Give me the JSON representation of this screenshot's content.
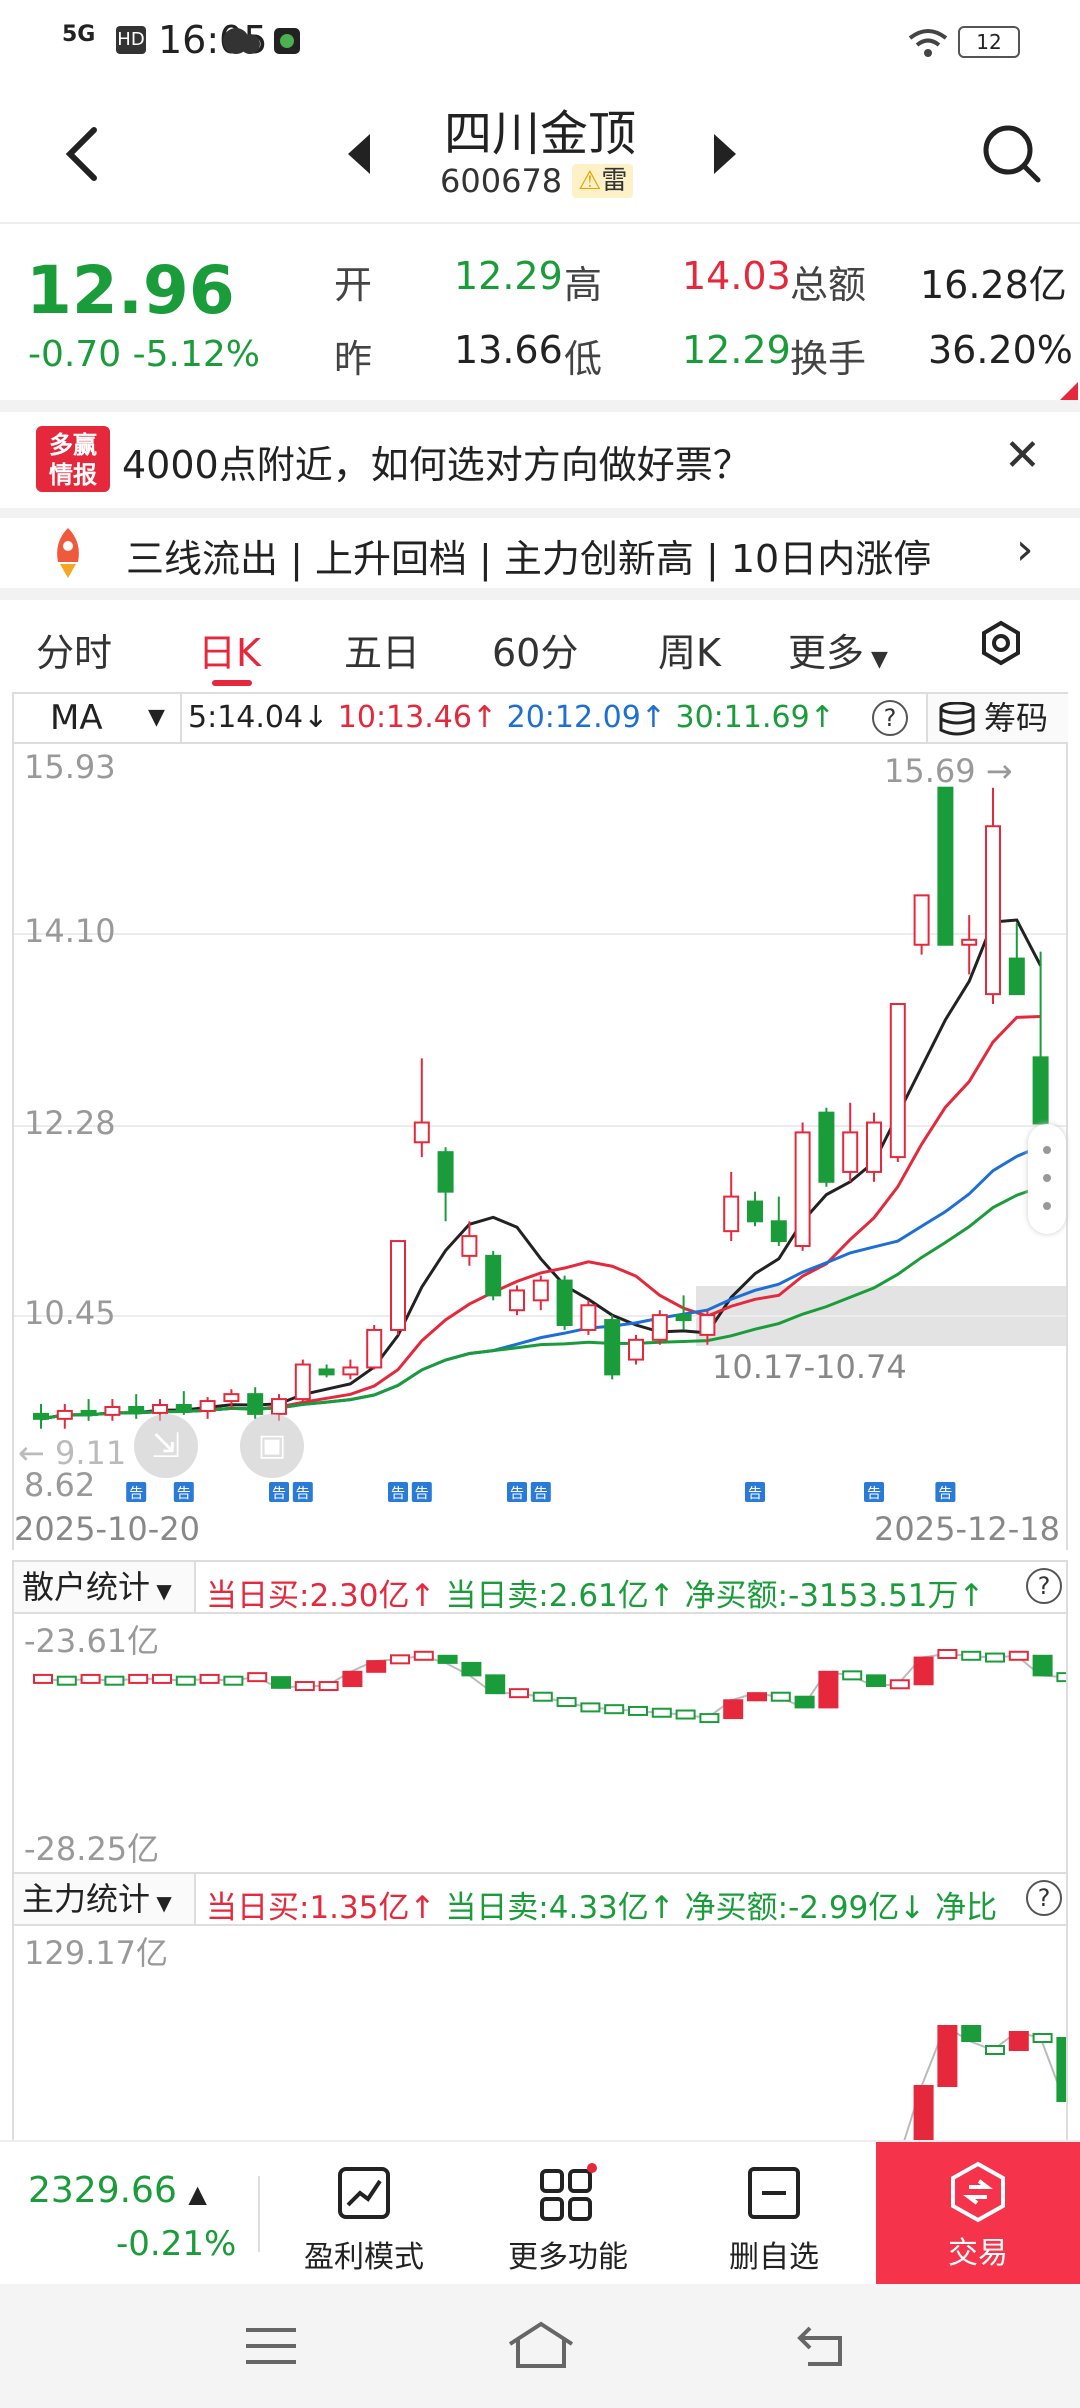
{
  "status_bar": {
    "time": "16:05",
    "network": "5G",
    "hd": "HD",
    "battery": "12"
  },
  "header": {
    "stock_name": "四川金顶",
    "stock_code": "600678",
    "risk_tag": "雷"
  },
  "quote": {
    "price": "12.96",
    "change": "-0.70",
    "change_pct": "-5.12%",
    "open_label": "开",
    "open": "12.29",
    "high_label": "高",
    "high": "14.03",
    "amount_label": "总额",
    "amount": "16.28亿",
    "prev_label": "昨",
    "prev": "13.66",
    "low_label": "低",
    "low": "12.29",
    "turnover_label": "换手",
    "turnover": "36.20%"
  },
  "news": {
    "logo_line1": "多赢",
    "logo_line2": "情报",
    "text": "4000点附近，如何选对方向做好票？"
  },
  "tags_bar": {
    "text": "三线流出 | 上升回档 | 主力创新高 | 10日内涨停"
  },
  "tabs": [
    {
      "label": "分时"
    },
    {
      "label": "日K"
    },
    {
      "label": "五日"
    },
    {
      "label": "60分"
    },
    {
      "label": "周K"
    },
    {
      "label": "更多"
    }
  ],
  "indicator": {
    "selected": "MA",
    "ma5": "5:14.04↓",
    "ma10": "10:13.46↑",
    "ma20": "20:12.09↑",
    "ma30": "30:11.69↑",
    "chip_label": "筹码"
  },
  "chart_data": {
    "type": "candlestick",
    "y_ticks": [
      "15.93",
      "14.10",
      "12.28",
      "10.45",
      "8.62"
    ],
    "ylim": [
      8.62,
      15.93
    ],
    "x_start": "2025-10-20",
    "x_end": "2025-12-18",
    "annotations": {
      "high_marker": "15.69",
      "low_marker": "9.11",
      "zone": "10.17-10.74",
      "notice": "告"
    },
    "colors": {
      "up": "#e5283c",
      "down": "#1a9c3b",
      "ma5": "#222222",
      "ma10": "#e5283c",
      "ma20": "#1d6fd6",
      "ma30": "#1a9c3b"
    },
    "candles": [
      {
        "o": 9.35,
        "h": 9.45,
        "l": 9.2,
        "c": 9.3
      },
      {
        "o": 9.3,
        "h": 9.45,
        "l": 9.2,
        "c": 9.38
      },
      {
        "o": 9.38,
        "h": 9.5,
        "l": 9.28,
        "c": 9.34
      },
      {
        "o": 9.34,
        "h": 9.5,
        "l": 9.28,
        "c": 9.42
      },
      {
        "o": 9.42,
        "h": 9.55,
        "l": 9.3,
        "c": 9.36
      },
      {
        "o": 9.36,
        "h": 9.5,
        "l": 9.28,
        "c": 9.44
      },
      {
        "o": 9.44,
        "h": 9.58,
        "l": 9.34,
        "c": 9.38
      },
      {
        "o": 9.38,
        "h": 9.52,
        "l": 9.3,
        "c": 9.48
      },
      {
        "o": 9.48,
        "h": 9.6,
        "l": 9.4,
        "c": 9.55
      },
      {
        "o": 9.55,
        "h": 9.62,
        "l": 9.3,
        "c": 9.35
      },
      {
        "o": 9.35,
        "h": 9.55,
        "l": 9.28,
        "c": 9.5
      },
      {
        "o": 9.5,
        "h": 9.9,
        "l": 9.48,
        "c": 9.85
      },
      {
        "o": 9.8,
        "h": 9.85,
        "l": 9.72,
        "c": 9.75
      },
      {
        "o": 9.75,
        "h": 9.9,
        "l": 9.7,
        "c": 9.82
      },
      {
        "o": 9.82,
        "h": 10.25,
        "l": 9.8,
        "c": 10.2
      },
      {
        "o": 10.2,
        "h": 11.1,
        "l": 10.15,
        "c": 11.1
      },
      {
        "o": 12.1,
        "h": 12.95,
        "l": 11.95,
        "c": 12.3
      },
      {
        "o": 12.0,
        "h": 12.05,
        "l": 11.3,
        "c": 11.6
      },
      {
        "o": 10.95,
        "h": 11.3,
        "l": 10.85,
        "c": 11.15
      },
      {
        "o": 10.95,
        "h": 11.0,
        "l": 10.5,
        "c": 10.55
      },
      {
        "o": 10.4,
        "h": 10.65,
        "l": 10.35,
        "c": 10.6
      },
      {
        "o": 10.5,
        "h": 10.75,
        "l": 10.4,
        "c": 10.7
      },
      {
        "o": 10.7,
        "h": 10.75,
        "l": 10.2,
        "c": 10.25
      },
      {
        "o": 10.2,
        "h": 10.5,
        "l": 10.15,
        "c": 10.45
      },
      {
        "o": 10.3,
        "h": 10.35,
        "l": 9.7,
        "c": 9.75
      },
      {
        "o": 9.9,
        "h": 10.15,
        "l": 9.85,
        "c": 10.1
      },
      {
        "o": 10.1,
        "h": 10.4,
        "l": 10.05,
        "c": 10.35
      },
      {
        "o": 10.35,
        "h": 10.55,
        "l": 10.2,
        "c": 10.3
      },
      {
        "o": 10.15,
        "h": 10.4,
        "l": 10.05,
        "c": 10.35
      },
      {
        "o": 11.2,
        "h": 11.8,
        "l": 11.1,
        "c": 11.55
      },
      {
        "o": 11.5,
        "h": 11.6,
        "l": 11.25,
        "c": 11.3
      },
      {
        "o": 11.3,
        "h": 11.55,
        "l": 11.05,
        "c": 11.1
      },
      {
        "o": 11.05,
        "h": 12.3,
        "l": 11.0,
        "c": 12.2
      },
      {
        "o": 12.4,
        "h": 12.45,
        "l": 11.65,
        "c": 11.7
      },
      {
        "o": 11.8,
        "h": 12.5,
        "l": 11.7,
        "c": 12.2
      },
      {
        "o": 11.8,
        "h": 12.4,
        "l": 11.7,
        "c": 12.3
      },
      {
        "o": 11.95,
        "h": 13.5,
        "l": 11.9,
        "c": 13.5
      },
      {
        "o": 14.1,
        "h": 14.6,
        "l": 14.0,
        "c": 14.6
      },
      {
        "o": 15.69,
        "h": 15.69,
        "l": 14.1,
        "c": 14.1
      },
      {
        "o": 14.1,
        "h": 14.4,
        "l": 13.8,
        "c": 14.15
      },
      {
        "o": 13.6,
        "h": 15.69,
        "l": 13.5,
        "c": 15.3
      },
      {
        "o": 13.96,
        "h": 14.32,
        "l": 13.6,
        "c": 13.6
      },
      {
        "o": 12.96,
        "h": 14.03,
        "l": 12.29,
        "c": 12.29
      }
    ]
  },
  "retail_panel": {
    "name": "散户统计",
    "buy": "当日买:2.30亿↑",
    "sell": "当日卖:2.61亿↑",
    "net": "净买额:-3153.51万↑",
    "y_top": "-23.61亿",
    "y_bottom": "-28.25亿",
    "values": [
      0.86,
      0.85,
      0.86,
      0.85,
      0.86,
      0.86,
      0.85,
      0.86,
      0.85,
      0.87,
      0.81,
      0.82,
      0.82,
      0.9,
      0.96,
      0.97,
      0.99,
      0.95,
      0.88,
      0.78,
      0.78,
      0.76,
      0.73,
      0.7,
      0.69,
      0.68,
      0.67,
      0.66,
      0.64,
      0.74,
      0.78,
      0.76,
      0.7,
      0.9,
      0.88,
      0.82,
      0.83,
      0.98,
      1.0,
      0.99,
      0.98,
      0.99,
      0.88,
      0.87
    ]
  },
  "main_panel": {
    "name": "主力统计",
    "buy": "当日买:1.35亿↑",
    "sell": "当日卖:4.33亿↑",
    "net": "净买额:-2.99亿↓ 净比",
    "y_top": "129.17亿",
    "values": [
      0.0,
      0.0,
      0.0,
      0.0,
      0.0,
      0.0,
      0.0,
      0.0,
      0.0,
      0.0,
      0.0,
      0.0,
      0.0,
      0.0,
      0.0,
      0.0,
      0.2,
      0.22,
      0.12,
      0.05,
      0.05,
      0.05,
      0.06,
      0.05,
      0.06,
      0.06,
      0.07,
      0.07,
      0.07,
      0.08,
      0.09,
      0.12,
      0.1,
      0.09,
      0.28,
      0.3,
      0.35,
      0.6,
      0.8,
      0.75,
      0.72,
      0.78,
      0.76,
      0.55
    ]
  },
  "bottom_bar": {
    "index_value": "2329.66",
    "index_change": "-0.21%",
    "items": [
      {
        "label": "盈利模式"
      },
      {
        "label": "更多功能"
      },
      {
        "label": "删自选"
      }
    ],
    "trade_label": "交易"
  }
}
